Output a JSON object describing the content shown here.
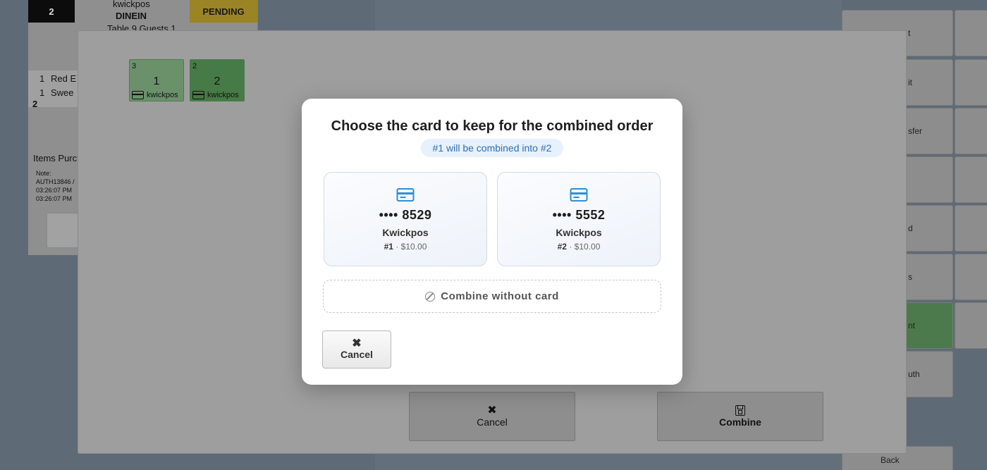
{
  "background": {
    "order_number": "2",
    "server": "kwickpos",
    "order_type": "DINEIN",
    "table_info": "Table 9 Guests 1",
    "status": "PENDING",
    "items": [
      {
        "qty": "1",
        "name": "Red E"
      },
      {
        "qty": "1",
        "name": "Swee"
      }
    ],
    "items_count": "2",
    "items_purchased_label": "Items Purc",
    "note_lines": [
      "Note:",
      "AUTH13846 /",
      "03:26:07 PM",
      "03:26:07 PM"
    ],
    "right_buttons": [
      "t",
      "it",
      "sfer",
      "",
      "d",
      "s",
      "nt",
      "uth",
      "Back"
    ]
  },
  "combine_dialog": {
    "orders": [
      {
        "count": "3",
        "number": "1",
        "card_holder": "kwickpos"
      },
      {
        "count": "2",
        "number": "2",
        "card_holder": "kwickpos"
      }
    ],
    "cancel_label": "Cancel",
    "combine_label": "Combine"
  },
  "modal": {
    "title": "Choose the card to keep for the combined order",
    "subtitle": "#1 will be combined into #2",
    "cards": [
      {
        "digits": "•••• 8529",
        "name": "Kwickpos",
        "order": "#1",
        "amount": "· $10.00"
      },
      {
        "digits": "•••• 5552",
        "name": "Kwickpos",
        "order": "#2",
        "amount": "· $10.00"
      }
    ],
    "combine_without_card_label": "Combine without card",
    "cancel_label": "Cancel"
  },
  "colors": {
    "accent": "#2f8fd6",
    "pill_bg": "#e6f1fb",
    "pill_text": "#2f6fb3",
    "pending": "#9a8425",
    "order_green": "#467a46"
  }
}
